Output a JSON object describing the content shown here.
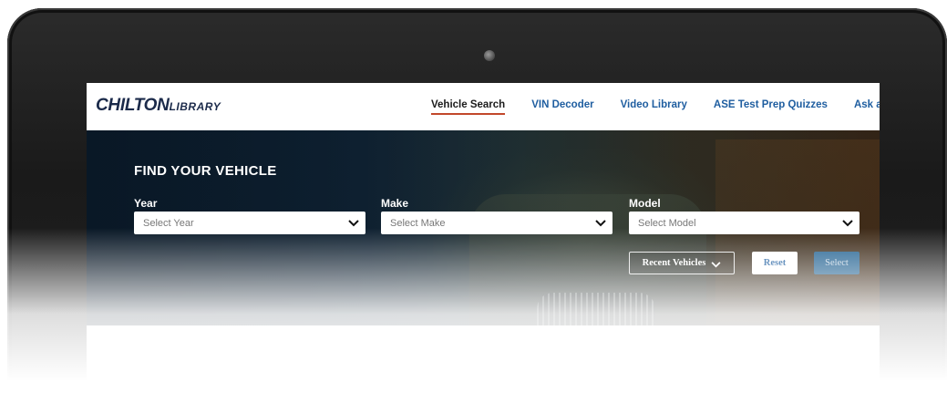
{
  "header": {
    "logo_main": "CHILTON",
    "logo_sub": "LIBRARY",
    "nav": [
      {
        "label": "Vehicle Search",
        "active": true
      },
      {
        "label": "VIN Decoder",
        "active": false
      },
      {
        "label": "Video Library",
        "active": false
      },
      {
        "label": "ASE Test Prep Quizzes",
        "active": false
      },
      {
        "label": "Ask an Exper",
        "active": false
      }
    ]
  },
  "hero": {
    "title": "FIND YOUR VEHICLE",
    "year": {
      "label": "Year",
      "placeholder": "Select Year"
    },
    "make": {
      "label": "Make",
      "placeholder": "Select Make"
    },
    "model": {
      "label": "Model",
      "placeholder": "Select Model"
    },
    "recent_label": "Recent Vehicles",
    "reset_label": "Reset",
    "select_label": "Select"
  },
  "icons": {
    "chevron": "chevron-down-icon",
    "camera": "camera-icon"
  },
  "colors": {
    "accent_underline": "#c2482b",
    "nav_link": "#1f5ea0",
    "select_button": "#1f5f8f",
    "logo": "#1b2a4a"
  }
}
